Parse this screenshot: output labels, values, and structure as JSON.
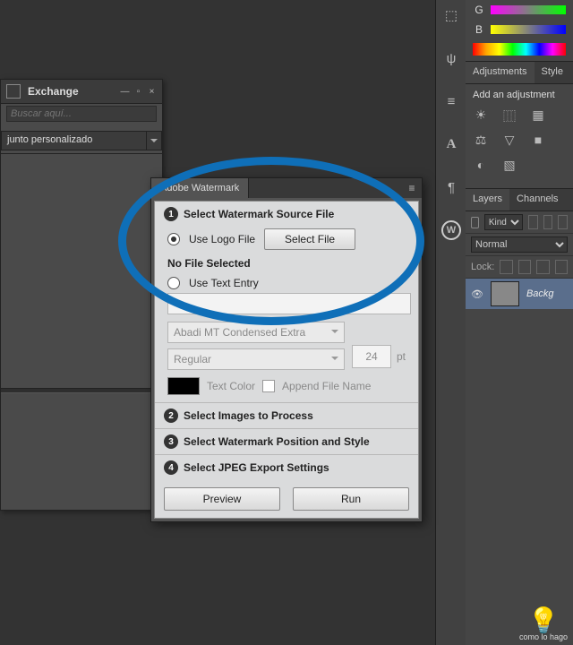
{
  "exchange": {
    "title": "Exchange",
    "search_placeholder": "Buscar aquí...",
    "dropdown": "junto personalizado"
  },
  "channels": {
    "g": "G",
    "b": "B"
  },
  "adjustments": {
    "tab1": "Adjustments",
    "tab2": "Style",
    "heading": "Add an adjustment"
  },
  "layers": {
    "tab1": "Layers",
    "tab2": "Channels",
    "kind": "Kind",
    "blend": "Normal",
    "lock": "Lock:",
    "layer_name": "Backg"
  },
  "watermark": {
    "tab": "Adobe Watermark",
    "step1": "Select Watermark Source File",
    "use_logo": "Use Logo File",
    "select_file": "Select File",
    "no_file": "No File Selected",
    "use_text": "Use Text Entry",
    "font": "Abadi MT Condensed Extra",
    "weight": "Regular",
    "size": "24",
    "pt": "pt",
    "textcolor": "Text Color",
    "append": "Append File Name",
    "step2": "Select Images to Process",
    "step3": "Select Watermark Position and Style",
    "step4": "Select JPEG Export Settings",
    "preview": "Preview",
    "run": "Run"
  },
  "logo": {
    "brand": "como lo hago",
    "energy": "⚡"
  }
}
